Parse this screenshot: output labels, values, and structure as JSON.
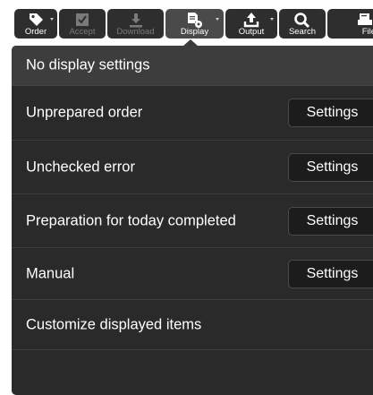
{
  "toolbar": {
    "buttons": [
      {
        "label": "Order",
        "icon": "tag-icon",
        "enabled": true
      },
      {
        "label": "Accept",
        "icon": "checkbox-icon",
        "enabled": false
      },
      {
        "label": "Download",
        "icon": "download-icon",
        "enabled": false
      },
      {
        "label": "Display",
        "icon": "display-settings-icon",
        "enabled": true,
        "active": true
      },
      {
        "label": "Output",
        "icon": "upload-icon",
        "enabled": true
      },
      {
        "label": "Search",
        "icon": "search-icon",
        "enabled": true
      },
      {
        "label": "File",
        "icon": "file-icon",
        "enabled": true
      }
    ]
  },
  "menu": {
    "items": [
      {
        "label": "No display settings"
      },
      {
        "label": "Unprepared order",
        "button": "Settings"
      },
      {
        "label": "Unchecked error",
        "button": "Settings"
      },
      {
        "label": "Preparation for today completed",
        "button": "Settings"
      },
      {
        "label": "Manual",
        "button": "Settings"
      },
      {
        "label": "Customize displayed items"
      }
    ]
  },
  "colors": {
    "toolbar_button": "#2e2e2e",
    "menu_background": "#2a2a2a",
    "menu_highlight": "#3d3d3d",
    "disabled_text": "#7a7a7a"
  }
}
